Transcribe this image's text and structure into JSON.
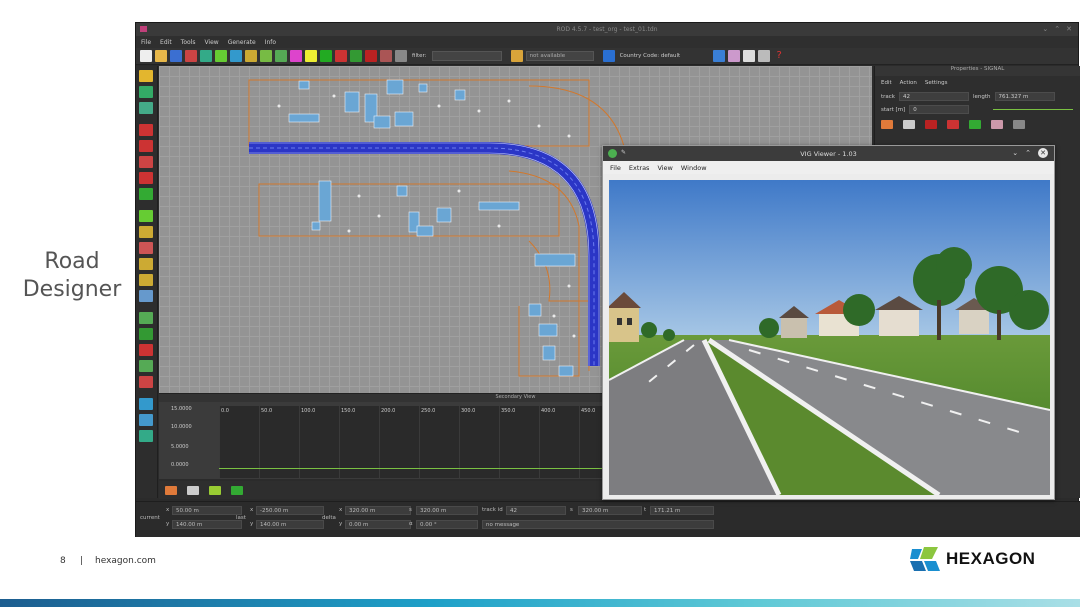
{
  "slide": {
    "side_title_line1": "Road",
    "side_title_line2": "Designer",
    "page_number": "8",
    "separator": "|",
    "footer_url": "hexagon.com",
    "logo_text": "HEXAGON",
    "colors": {
      "logo_blue": "#1a8fd0",
      "logo_green": "#8cc63f",
      "bar_dark": "#1d5d8f",
      "bar_light": "#5fc9d6"
    }
  },
  "app": {
    "window_title": "ROD 4.5.7 - test_org - test_01.tdn",
    "menu": [
      "File",
      "Edit",
      "Tools",
      "View",
      "Generate",
      "Info"
    ],
    "toolbar": {
      "filter_label": "filter:",
      "filter_value": "",
      "availability_value": "not available",
      "country_code_label": "Country Code: default"
    },
    "secondary_view_title": "Secondary View",
    "secondary_y_labels": [
      "15.0000",
      "10.0000",
      "5.0000",
      "0.0000"
    ],
    "secondary_x_labels": [
      "0.0",
      "50.0",
      "100.0",
      "150.0",
      "200.0",
      "250.0",
      "300.0",
      "350.0",
      "400.0",
      "450.0"
    ],
    "status": {
      "current_label": "current",
      "last_label": "last",
      "delta_label": "delta",
      "x1": "50.00 m",
      "y1": "140.00 m",
      "x2": "-250.00 m",
      "y2": "140.00 m",
      "dx": "320.00 m",
      "dy": "0.00 m",
      "s_val": "320.00 m",
      "a_val": "0.00 °",
      "track_id_label": "track id",
      "track_id": "42",
      "s_field": "320.00 m",
      "t_field": "171.21 m",
      "message": "no message"
    },
    "properties": {
      "header": "Properties - SIGNAL",
      "menu": [
        "Edit",
        "Action",
        "Settings"
      ],
      "track_label": "track",
      "track_value": "42",
      "length_label": "length",
      "length_value": "761.327 m",
      "start_label": "start [m]",
      "start_value": "0"
    }
  },
  "vig": {
    "title": "VIG Viewer - 1.03",
    "menu": [
      "File",
      "Extras",
      "View",
      "Window"
    ]
  }
}
